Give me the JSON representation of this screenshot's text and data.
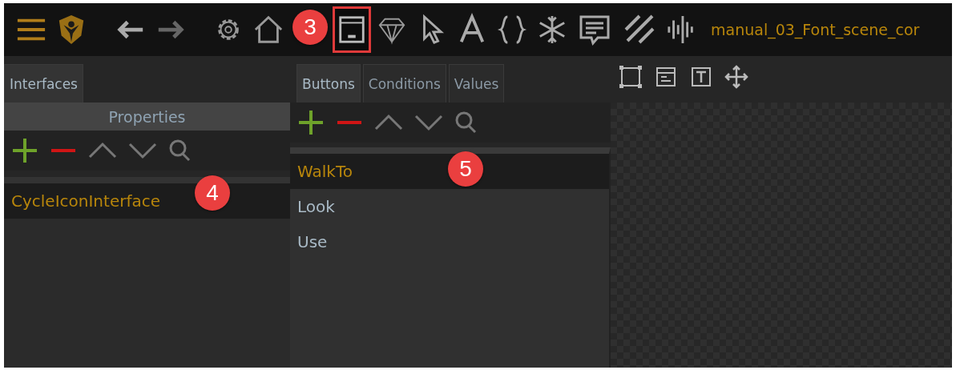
{
  "toolbar": {
    "icons": [
      {
        "kind": "menu",
        "selected": false
      },
      {
        "kind": "logo",
        "selected": false
      },
      {
        "kind": "back",
        "selected": false
      },
      {
        "kind": "forward",
        "selected": false
      },
      {
        "kind": "gear",
        "selected": false
      },
      {
        "kind": "home",
        "selected": false
      },
      {
        "kind": "window",
        "selected": true
      },
      {
        "kind": "diamond",
        "selected": false
      },
      {
        "kind": "cursor",
        "selected": false
      },
      {
        "kind": "font",
        "selected": false
      },
      {
        "kind": "braces",
        "selected": false
      },
      {
        "kind": "snowflake",
        "selected": false
      },
      {
        "kind": "speech",
        "selected": false
      },
      {
        "kind": "hatch",
        "selected": false
      },
      {
        "kind": "wave",
        "selected": false
      }
    ],
    "title": "manual_03_Font_scene_cor",
    "callout": "3"
  },
  "interfaces_panel": {
    "tabs": [
      {
        "label": "Interfaces",
        "selected": true
      }
    ],
    "header": "Properties",
    "items": [
      {
        "label": "CycleIconInterface",
        "selected": true
      }
    ],
    "callout": "4"
  },
  "buttons_panel": {
    "tabs": [
      {
        "label": "Buttons",
        "selected": true
      },
      {
        "label": "Conditions",
        "selected": false
      },
      {
        "label": "Values",
        "selected": false
      }
    ],
    "items": [
      {
        "label": "WalkTo",
        "selected": true
      },
      {
        "label": "Look",
        "selected": false
      },
      {
        "label": "Use",
        "selected": false
      }
    ],
    "callout": "5"
  }
}
